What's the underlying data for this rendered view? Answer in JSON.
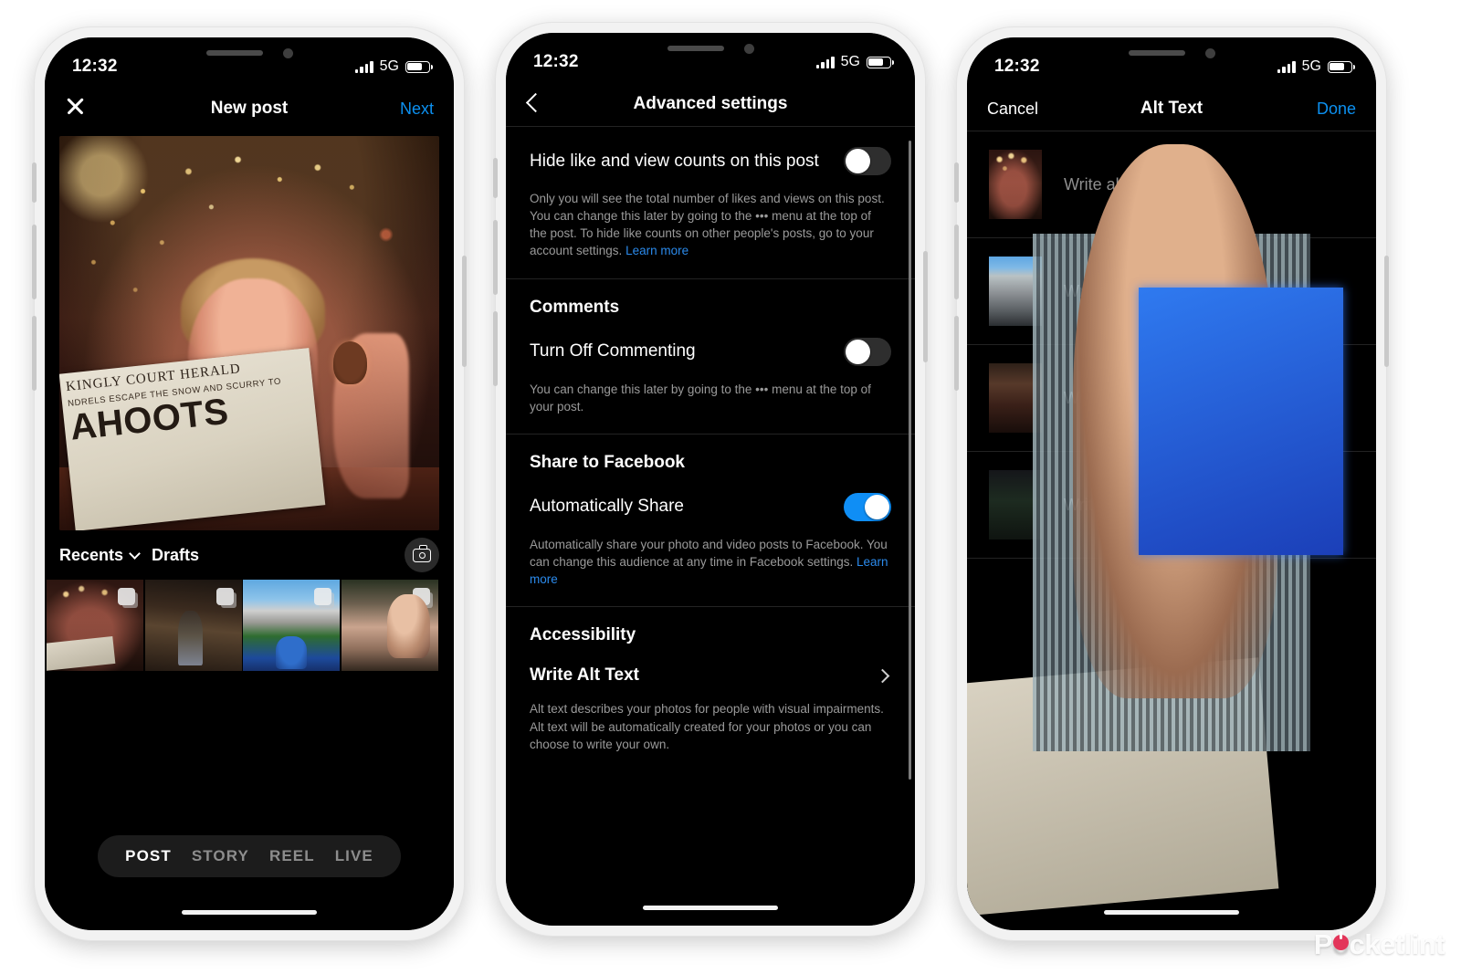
{
  "watermark": {
    "pre": "P",
    "o": "o",
    "post": "cketlint"
  },
  "status_bar": {
    "time": "12:32",
    "network": "5G",
    "battery_level": 72
  },
  "colors": {
    "accent_blue": "#0c90f0",
    "toggle_on": "#0f8ef5",
    "link_blue": "#2b8aeb",
    "muted_text": "#9a9a9a",
    "screen_bg": "#000000"
  },
  "phone1": {
    "nav": {
      "close_icon": "close-icon",
      "title": "New post",
      "next_label": "Next"
    },
    "gallery": {
      "recents_label": "Recents",
      "chevron_icon": "chevron-down-icon",
      "drafts_label": "Drafts",
      "camera_icon": "camera-icon"
    },
    "thumbnails": [
      {
        "name": "thumb-newspaper-bar"
      },
      {
        "name": "thumb-person-archway"
      },
      {
        "name": "thumb-stadium"
      },
      {
        "name": "thumb-person-coffee"
      }
    ],
    "hero_photo": {
      "headline_line1": "KINGLY COURT HERALD",
      "headline_line2": "NDRELS ESCAPE THE SNOW AND SCURRY TO",
      "headline_line3": "AHOOTS"
    },
    "mode_tabs": [
      {
        "label": "POST",
        "active": true
      },
      {
        "label": "STORY",
        "active": false
      },
      {
        "label": "REEL",
        "active": false
      },
      {
        "label": "LIVE",
        "active": false
      }
    ]
  },
  "phone2": {
    "nav": {
      "back_icon": "back-chevron-icon",
      "title": "Advanced settings"
    },
    "rows": {
      "hide_counts": {
        "label": "Hide like and view counts on this post",
        "toggle_state": "off",
        "help": "Only you will see the total number of likes and views on this post. You can change this later by going to the ••• menu at the top of the post. To hide like counts on other people's posts, go to your account settings. ",
        "help_link": "Learn more"
      },
      "comments_title": "Comments",
      "turn_off_commenting": {
        "label": "Turn Off Commenting",
        "toggle_state": "off",
        "help": "You can change this later by going to the ••• menu at the top of your post."
      },
      "share_to_facebook_title": "Share to Facebook",
      "automatically_share": {
        "label": "Automatically Share",
        "toggle_state": "on",
        "help": "Automatically share your photo and video posts to Facebook. You can change this audience at any time in Facebook settings. ",
        "help_link": "Learn more"
      },
      "accessibility_title": "Accessibility",
      "write_alt_text": {
        "label": "Write Alt Text",
        "chevron_icon": "chevron-right-icon",
        "help": "Alt text describes your photos for people with visual impairments. Alt text will be automatically created for your photos or you can choose to write your own."
      }
    }
  },
  "phone3": {
    "nav": {
      "cancel_label": "Cancel",
      "title": "Alt Text",
      "done_label": "Done"
    },
    "rows": [
      {
        "thumb": "thumb-newspaper-bar",
        "placeholder": "Write alt text..."
      },
      {
        "thumb": "thumb-building-facade",
        "placeholder": "Write alt text..."
      },
      {
        "thumb": "thumb-portrait-red-dress",
        "placeholder": "Write alt text..."
      },
      {
        "thumb": "thumb-tv-christmas-tree",
        "placeholder": "Write alt text..."
      }
    ]
  }
}
